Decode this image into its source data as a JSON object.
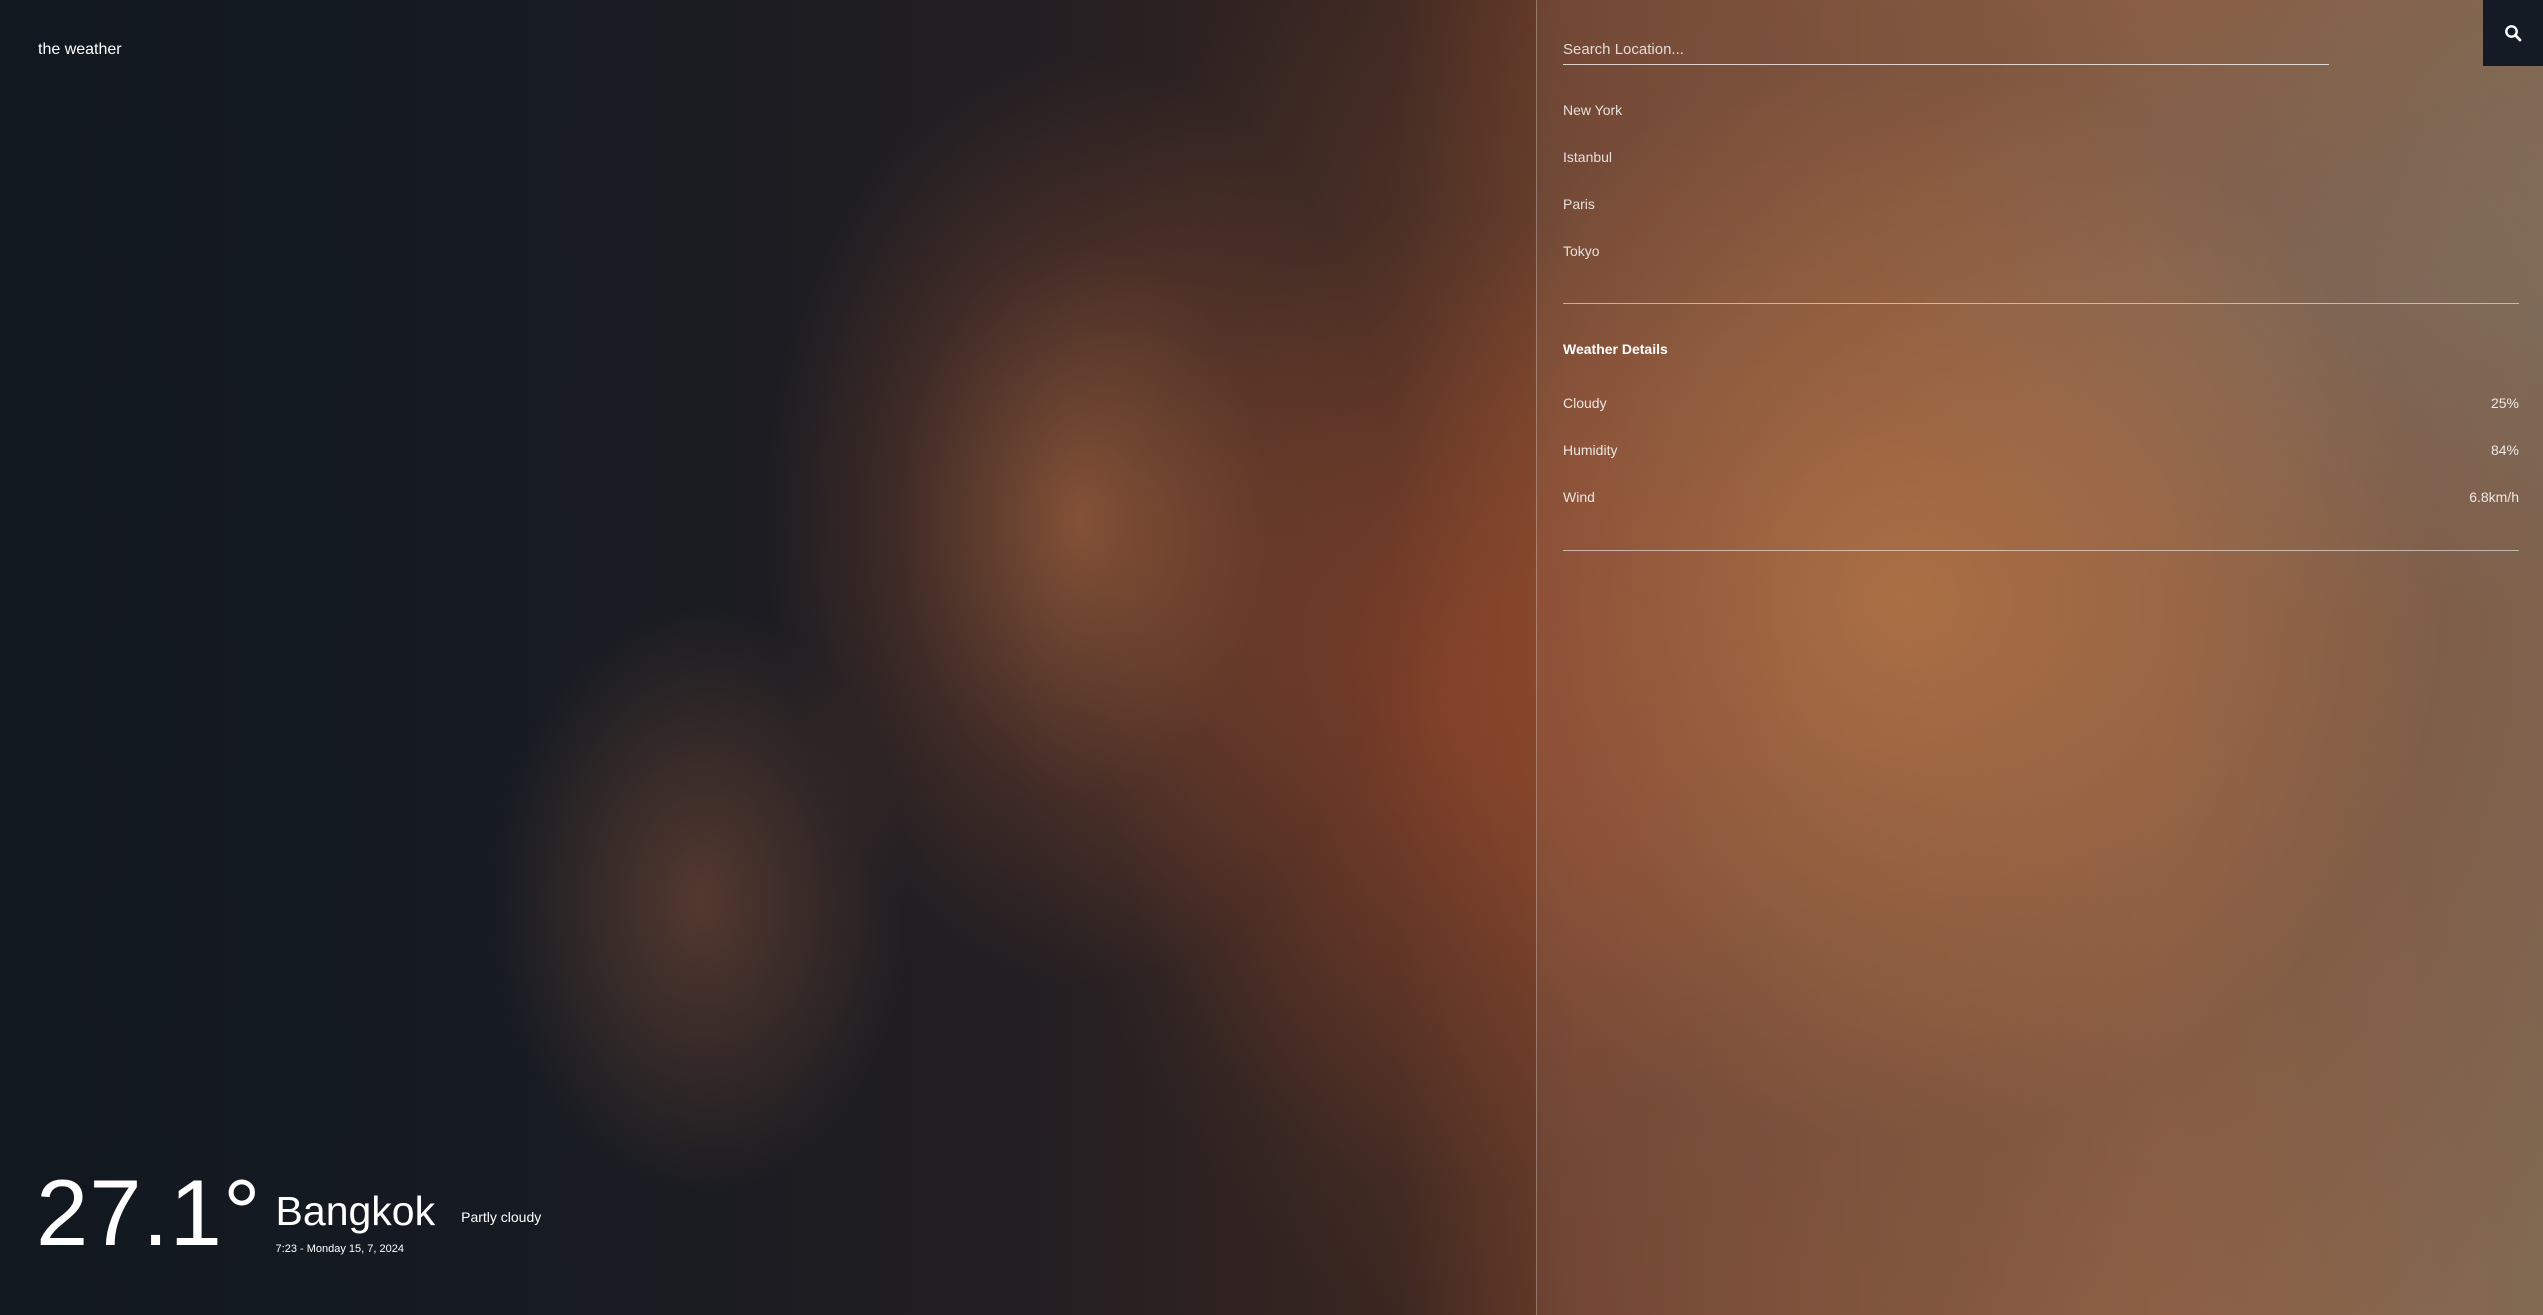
{
  "app": {
    "brand": "the weather"
  },
  "search": {
    "placeholder": "Search Location...",
    "button_icon": "search-icon"
  },
  "locations": [
    "New York",
    "Istanbul",
    "Paris",
    "Tokyo"
  ],
  "details": {
    "title": "Weather Details",
    "rows": [
      {
        "label": "Cloudy",
        "value": "25%"
      },
      {
        "label": "Humidity",
        "value": "84%"
      },
      {
        "label": "Wind",
        "value": "6.8km/h"
      }
    ]
  },
  "current": {
    "temperature": "27.1°",
    "city": "Bangkok",
    "datetime": "7:23 - Monday 15, 7, 2024",
    "condition": "Partly cloudy"
  }
}
